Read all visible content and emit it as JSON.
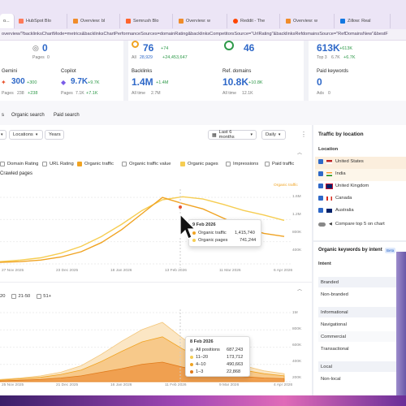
{
  "browser": {
    "tabs": [
      {
        "label": "o...",
        "color": "#e05020",
        "active": true
      },
      {
        "label": "HubSpot Blo",
        "color": "#ff7a59"
      },
      {
        "label": "Overview: bl",
        "color": "#f08c2a"
      },
      {
        "label": "Semrush Blo",
        "color": "#ff642d"
      },
      {
        "label": "Overview: w",
        "color": "#f08c2a"
      },
      {
        "label": "Reddit - The",
        "color": "#ff4500"
      },
      {
        "label": "Overview: w",
        "color": "#f08c2a"
      },
      {
        "label": "Zillow: Real",
        "color": "#1277e1"
      }
    ],
    "url": "overview/?backlinksChartMode=metrics&backlinksChartPerformanceSources=domainRating&backlinksCompetitorsSource=\"UrlRating\"&backlinksRefdomainsSource=\"RefDomainsNew\"&bestF"
  },
  "metrics": {
    "dr": {
      "value": "0",
      "sublabel": "Pages",
      "subvalue": "0"
    },
    "ur": {
      "value": "76",
      "delta": "+74",
      "sub_all": "All",
      "sub_all_val": "28,929",
      "sub_all_delta": "+24,453,647"
    },
    "refdom": {
      "value": "46"
    },
    "organic": {
      "value": "613K",
      "delta": "+613K",
      "top3_label": "Top 3",
      "top3_val": "6.7K",
      "top3_delta": "+6.7K"
    },
    "gemini": {
      "label": "Gemini",
      "value": "300",
      "delta": "+300",
      "pages_label": "Pages",
      "pages_val": "238",
      "pages_delta": "+238"
    },
    "copilot": {
      "label": "Copilot",
      "value": "9.7K",
      "delta": "+9.7K",
      "pages_label": "Pages",
      "pages_val": "7.1K",
      "pages_delta": "+7.1K"
    },
    "backlinks": {
      "label": "Backlinks",
      "value": "1.4M",
      "delta": "+1.4M",
      "alltime_label": "All time",
      "alltime_val": "2.7M"
    },
    "ref_domains": {
      "label": "Ref. domains",
      "value": "10.8K",
      "delta": "+10.8K",
      "alltime_label": "All time",
      "alltime_val": "12.1K"
    },
    "paid": {
      "label": "Paid keywords",
      "value": "0",
      "ads_label": "Ads",
      "ads_val": "0"
    }
  },
  "navtabs": {
    "a": "s",
    "b": "Organic search",
    "c": "Paid search"
  },
  "controls": {
    "loc": "Locations",
    "years": "Years",
    "range": "Last 6 months",
    "interval": "Daily"
  },
  "legend": {
    "domain_rating": "Domain Rating",
    "url_rating": "URL Rating",
    "organic_traffic": "Organic traffic",
    "organic_value": "Organic traffic value",
    "organic_pages": "Organic pages",
    "impressions": "Impressions",
    "paid_traffic": "Paid traffic",
    "crawled": "Crawled pages"
  },
  "chart1": {
    "x_ticks": [
      "27 Nov 2025",
      "23 Dec 2025",
      "18 Jan 2026",
      "13 Feb 2026",
      "11 Mar 2026",
      "6 Apr 2026"
    ],
    "y_right_ticks": [
      "1.6M",
      "1.2M",
      "800K",
      "400K"
    ],
    "axis_title": "Organic traffic",
    "tooltip": {
      "date": "9 Feb 2026",
      "rows": [
        {
          "label": "Organic traffic",
          "value": "1,415,740",
          "color": "#f0a322"
        },
        {
          "label": "Organic pages",
          "value": "741,244",
          "color": "#f6cd52"
        }
      ]
    },
    "series_traffic": [
      0.02,
      0.03,
      0.05,
      0.09,
      0.16,
      0.28,
      0.45,
      0.66,
      0.87,
      0.79,
      0.72,
      0.6,
      0.48,
      0.4,
      0.36
    ],
    "series_pages": [
      0.03,
      0.05,
      0.08,
      0.14,
      0.23,
      0.36,
      0.52,
      0.7,
      0.84,
      0.88,
      0.85,
      0.78,
      0.7,
      0.64,
      0.57
    ]
  },
  "chart2": {
    "filters": [
      "20",
      "21-50",
      "51+"
    ],
    "x_ticks": [
      "25 Nov 2025",
      "21 Dec 2025",
      "16 Jan 2026",
      "11 Feb 2026",
      "9 Mar 2026",
      "4 Apr 2026"
    ],
    "y_right_ticks": [
      "1M",
      "800K",
      "600K",
      "400K",
      "200K"
    ],
    "tooltip": {
      "date": "8 Feb 2026",
      "rows": [
        {
          "label": "All positions",
          "value": "687,243",
          "color": "#bbbbbb"
        },
        {
          "label": "11–20",
          "value": "173,712",
          "color": "#f6cd52"
        },
        {
          "label": "4–10",
          "value": "490,663",
          "color": "#f0a322"
        },
        {
          "label": "1–3",
          "value": "22,868",
          "color": "#e07a1a"
        }
      ]
    },
    "series_total": [
      0.03,
      0.05,
      0.08,
      0.13,
      0.22,
      0.38,
      0.56,
      0.72,
      0.82,
      0.6,
      0.42,
      0.3,
      0.22,
      0.15,
      0.11
    ],
    "series_mid": [
      0.02,
      0.04,
      0.06,
      0.1,
      0.16,
      0.28,
      0.42,
      0.55,
      0.62,
      0.45,
      0.32,
      0.22,
      0.16,
      0.11,
      0.08
    ],
    "series_low": [
      0.01,
      0.02,
      0.03,
      0.05,
      0.08,
      0.13,
      0.18,
      0.24,
      0.27,
      0.2,
      0.14,
      0.1,
      0.07,
      0.05,
      0.04
    ]
  },
  "traffic_location": {
    "title": "Traffic by location",
    "col": "Location",
    "rows": [
      {
        "name": "United States",
        "flag": "us"
      },
      {
        "name": "India",
        "flag": "in"
      },
      {
        "name": "United Kingdom",
        "flag": "uk"
      },
      {
        "name": "Canada",
        "flag": "ca"
      },
      {
        "name": "Australia",
        "flag": "au"
      }
    ],
    "compare": "Compare top 5 on chart"
  },
  "intent": {
    "title": "Organic keywords by intent",
    "badge": "Beta",
    "col": "Intent",
    "rows": [
      "Branded",
      "Non-branded",
      "Informational",
      "Navigational",
      "Commercial",
      "Transactional",
      "Local",
      "Non-local"
    ]
  }
}
